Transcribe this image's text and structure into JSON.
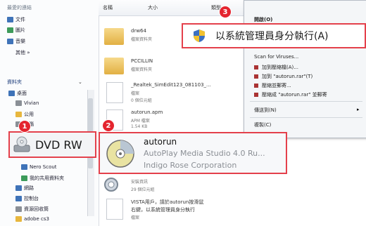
{
  "nav": {
    "favorites_header": "最愛的連結",
    "items_top": [
      {
        "label": "文件",
        "icon": "document-icon"
      },
      {
        "label": "圖片",
        "icon": "picture-icon"
      },
      {
        "label": "音樂",
        "icon": "music-icon"
      },
      {
        "label": "其他 »",
        "icon": ""
      }
    ],
    "folders_header": "資料夾",
    "items_tree": [
      {
        "label": "桌面",
        "icon": "desktop-icon"
      },
      {
        "label": "Vivian",
        "icon": "user-folder-icon"
      },
      {
        "label": "公用",
        "icon": "folder-icon"
      },
      {
        "label": "電腦",
        "icon": "computer-icon"
      }
    ],
    "items_bottom": [
      {
        "label": "Nero Scout",
        "icon": "nero-icon"
      },
      {
        "label": "我的共用資料夾",
        "icon": "shared-folder-icon"
      },
      {
        "label": "網路",
        "icon": "network-icon"
      },
      {
        "label": "控制台",
        "icon": "control-panel-icon"
      },
      {
        "label": "資源回收筒",
        "icon": "recycle-bin-icon"
      },
      {
        "label": "adobe cs3",
        "icon": "folder-icon"
      }
    ],
    "dvd_label": "DVD RW"
  },
  "columns": {
    "name": "名稱",
    "size": "大小",
    "type": "類型"
  },
  "files": [
    {
      "name": "drw64",
      "meta": "檔案資料夾"
    },
    {
      "name": "PCCILLIN",
      "meta": "檔案資料夾"
    },
    {
      "name": "_Realtek_SimEdit123_081103_...",
      "meta": "檔案",
      "meta2": "0 個位元組"
    },
    {
      "name": "autorun.apm",
      "meta": "APM 檔案",
      "meta2": "1.54 KB"
    },
    {
      "name": "",
      "meta": "安裝資訊",
      "meta2": "29 個位元組"
    },
    {
      "name": "VISTA用戶，請於autorun按滑鼠",
      "meta": "右鍵，以系統管理員身分執行",
      "meta2": "檔案"
    }
  ],
  "autorun": {
    "name": "autorun",
    "line2": "AutoPlay Media Studio 4.0 Ru...",
    "line3": "Indigo Rose Corporation"
  },
  "context_menu": {
    "open": "開啟(O)",
    "run_as_admin": "以系統管理員身分執行(A)",
    "scan": "Scan for Viruses...",
    "add_archive": "加到壓縮檔(A)...",
    "add_rar": "加到 \"autorun.rar\"(T)",
    "compress_email": "壓縮並郵寄...",
    "compress_rar_email": "壓縮成 \"autorun.rar\" 並郵寄",
    "send_to": "傳送到(N)",
    "copy": "複製(C)"
  },
  "badges": {
    "b1": "1",
    "b2": "2",
    "b3": "3"
  },
  "colors": {
    "highlight_border": "#e4404b",
    "badge": "#e4252f"
  }
}
